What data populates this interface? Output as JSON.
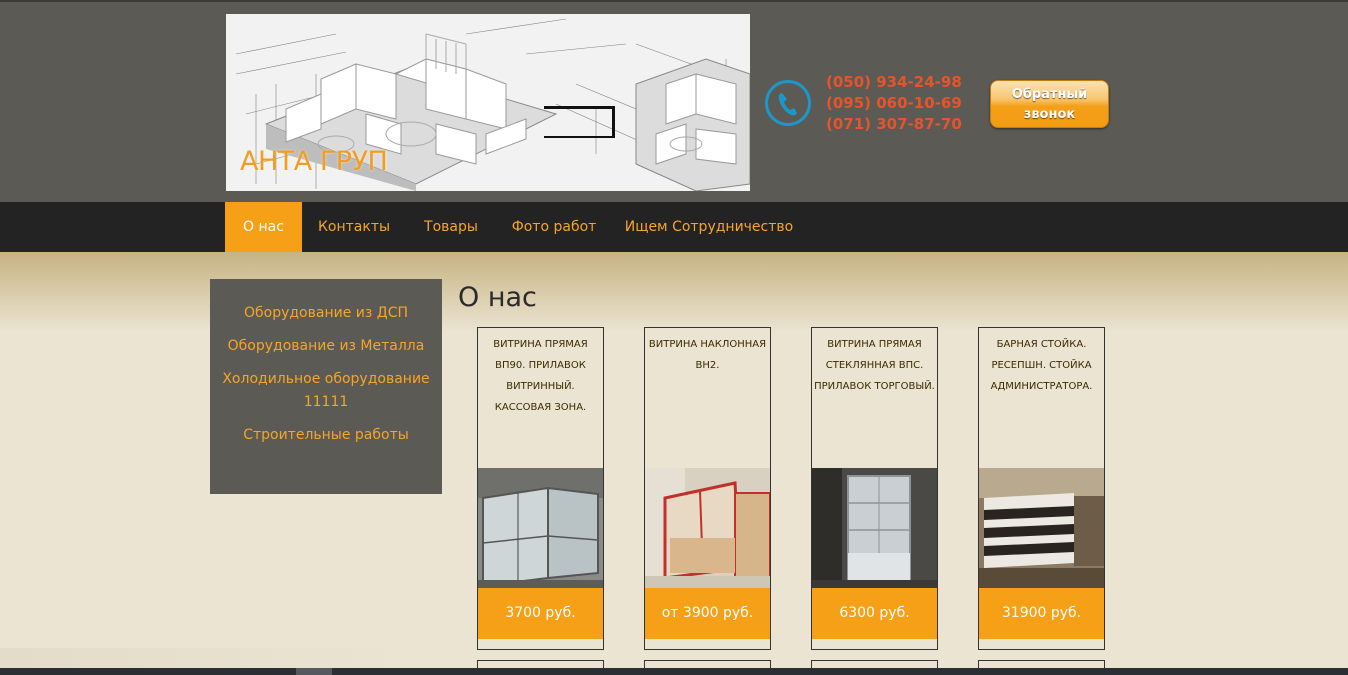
{
  "header": {
    "brand": "АНТА ГРУП",
    "phones": [
      "(050) 934-24-98",
      "(095) 060-10-69",
      "(071) 307-87-70"
    ],
    "callback_line1": "Обратный",
    "callback_line2": "звонок"
  },
  "nav": {
    "items": [
      "О нас",
      "Контакты",
      "Товары",
      "Фото работ",
      "Ищем Сотрудничество"
    ]
  },
  "sidebar": {
    "items": [
      "Оборудование из ДСП",
      "Оборудование из Металла",
      "Холодильное оборудование 11111",
      "Строительные работы"
    ]
  },
  "main": {
    "title": "О нас",
    "products": [
      {
        "title": "ВИТРИНА ПРЯМАЯ ВП90. ПРИЛАВОК ВИТРИННЫЙ. КАССОВАЯ ЗОНА.",
        "price": "3700 руб."
      },
      {
        "title": "ВИТРИНА НАКЛОННАЯ ВН2.",
        "price": "от 3900 руб."
      },
      {
        "title": "ВИТРИНА ПРЯМАЯ СТЕКЛЯННАЯ ВПС. ПРИЛАВОК ТОРГОВЫЙ.",
        "price": "6300 руб."
      },
      {
        "title": "БАРНАЯ СТОЙКА. РЕСЕПШН. СТОЙКА АДМИНИСТРАТОРА.",
        "price": "31900 руб."
      }
    ]
  },
  "colors": {
    "accent": "#f5a016",
    "header_bg": "#5b5a55",
    "nav_bg": "#232323",
    "phone_text": "#e8542a",
    "phone_icon": "#1c98c8",
    "page_bg": "#ebe4d2"
  },
  "icons": {
    "phone": "phone-icon",
    "banner": "architecture-render-image"
  }
}
